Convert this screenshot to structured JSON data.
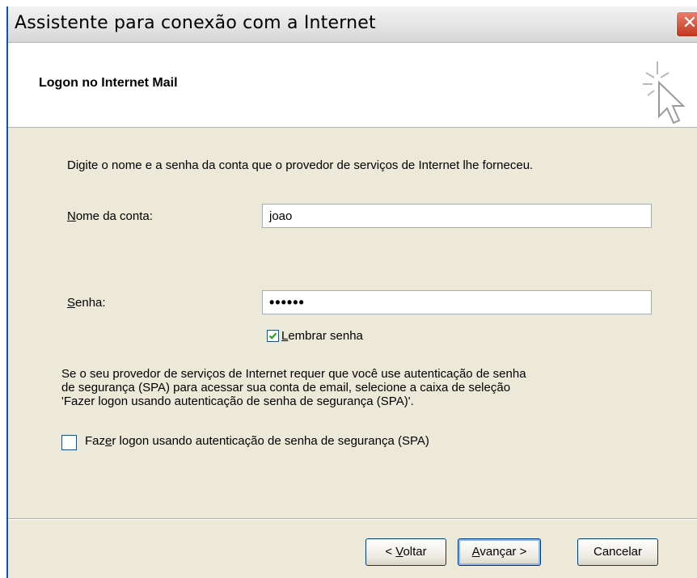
{
  "window": {
    "title": "Assistente para conexão com a Internet",
    "close_glyph": "✕"
  },
  "header": {
    "title": "Logon no Internet Mail"
  },
  "intro": "Digite o nome e a senha da conta que o provedor de serviços de Internet lhe forneceu.",
  "account": {
    "label_first": "N",
    "label_rest": "ome da conta:",
    "value": "joao"
  },
  "password": {
    "label_first": "S",
    "label_rest": "enha:",
    "value": "••••••"
  },
  "remember": {
    "checked": true,
    "label_first": "L",
    "label_rest": "embrar senha"
  },
  "description": {
    "line1": "Se o seu provedor de serviços de Internet requer que você use autenticação de senha",
    "line2": "de segurança (SPA) para acessar sua conta de email, selecione a caixa de seleção",
    "line3": "'Fazer logon usando autenticação de senha de segurança (SPA)'."
  },
  "spa": {
    "checked": false,
    "label_before": "Faz",
    "label_ul": "e",
    "label_after": "r logon usando autenticação de senha de segurança (SPA)"
  },
  "buttons": {
    "back_prefix": "< ",
    "back_ul": "V",
    "back_rest": "oltar",
    "next_ul": "A",
    "next_rest": "vançar >",
    "cancel": "Cancelar"
  },
  "colors": {
    "dialog_bg": "#ece9d8",
    "title_close": "#c2351f",
    "checkbox_border": "#1c5180"
  }
}
